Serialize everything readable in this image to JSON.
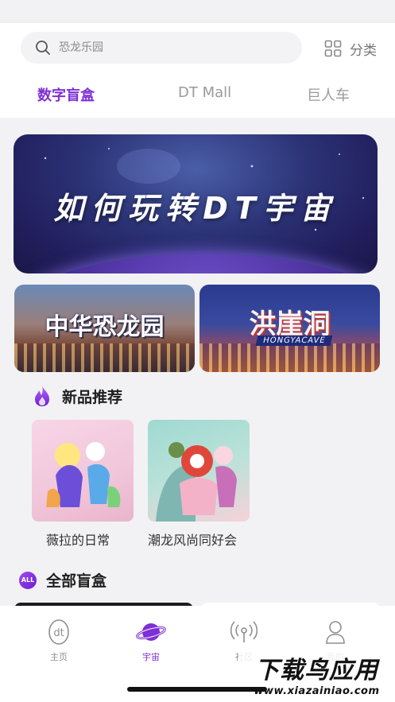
{
  "search": {
    "placeholder": "恐龙乐园",
    "icon": "search-icon"
  },
  "category": {
    "label": "分类",
    "icon": "grid-icon"
  },
  "tabs": [
    {
      "label": "数字盲盒",
      "active": true
    },
    {
      "label": "DT Mall",
      "active": false
    },
    {
      "label": "巨人车",
      "active": false
    }
  ],
  "banner": {
    "title": "如何玩转DT宇宙"
  },
  "sub_banners": [
    {
      "title": "中华恐龙园"
    },
    {
      "title": "洪崖洞",
      "caption": "HONGYACAVE"
    }
  ],
  "new_products": {
    "title": "新品推荐",
    "icon": "flame-icon",
    "items": [
      {
        "name": "薇拉的日常"
      },
      {
        "name": "潮龙风尚同好会"
      }
    ]
  },
  "all_boxes": {
    "title": "全部盲盒",
    "badge": "ALL"
  },
  "bottom_nav": [
    {
      "label": "主页",
      "icon": "dt-home-icon",
      "active": false
    },
    {
      "label": "宇宙",
      "icon": "planet-icon",
      "active": true
    },
    {
      "label": "社区",
      "icon": "broadcast-icon",
      "active": false
    },
    {
      "label": "我的",
      "icon": "user-icon",
      "active": false
    }
  ],
  "watermark": {
    "title": "下载鸟应用",
    "url": "www.xiazainiao.com"
  },
  "colors": {
    "accent": "#7e2fd6",
    "inactive": "#9a9a9a",
    "background": "#f2f2f4"
  }
}
